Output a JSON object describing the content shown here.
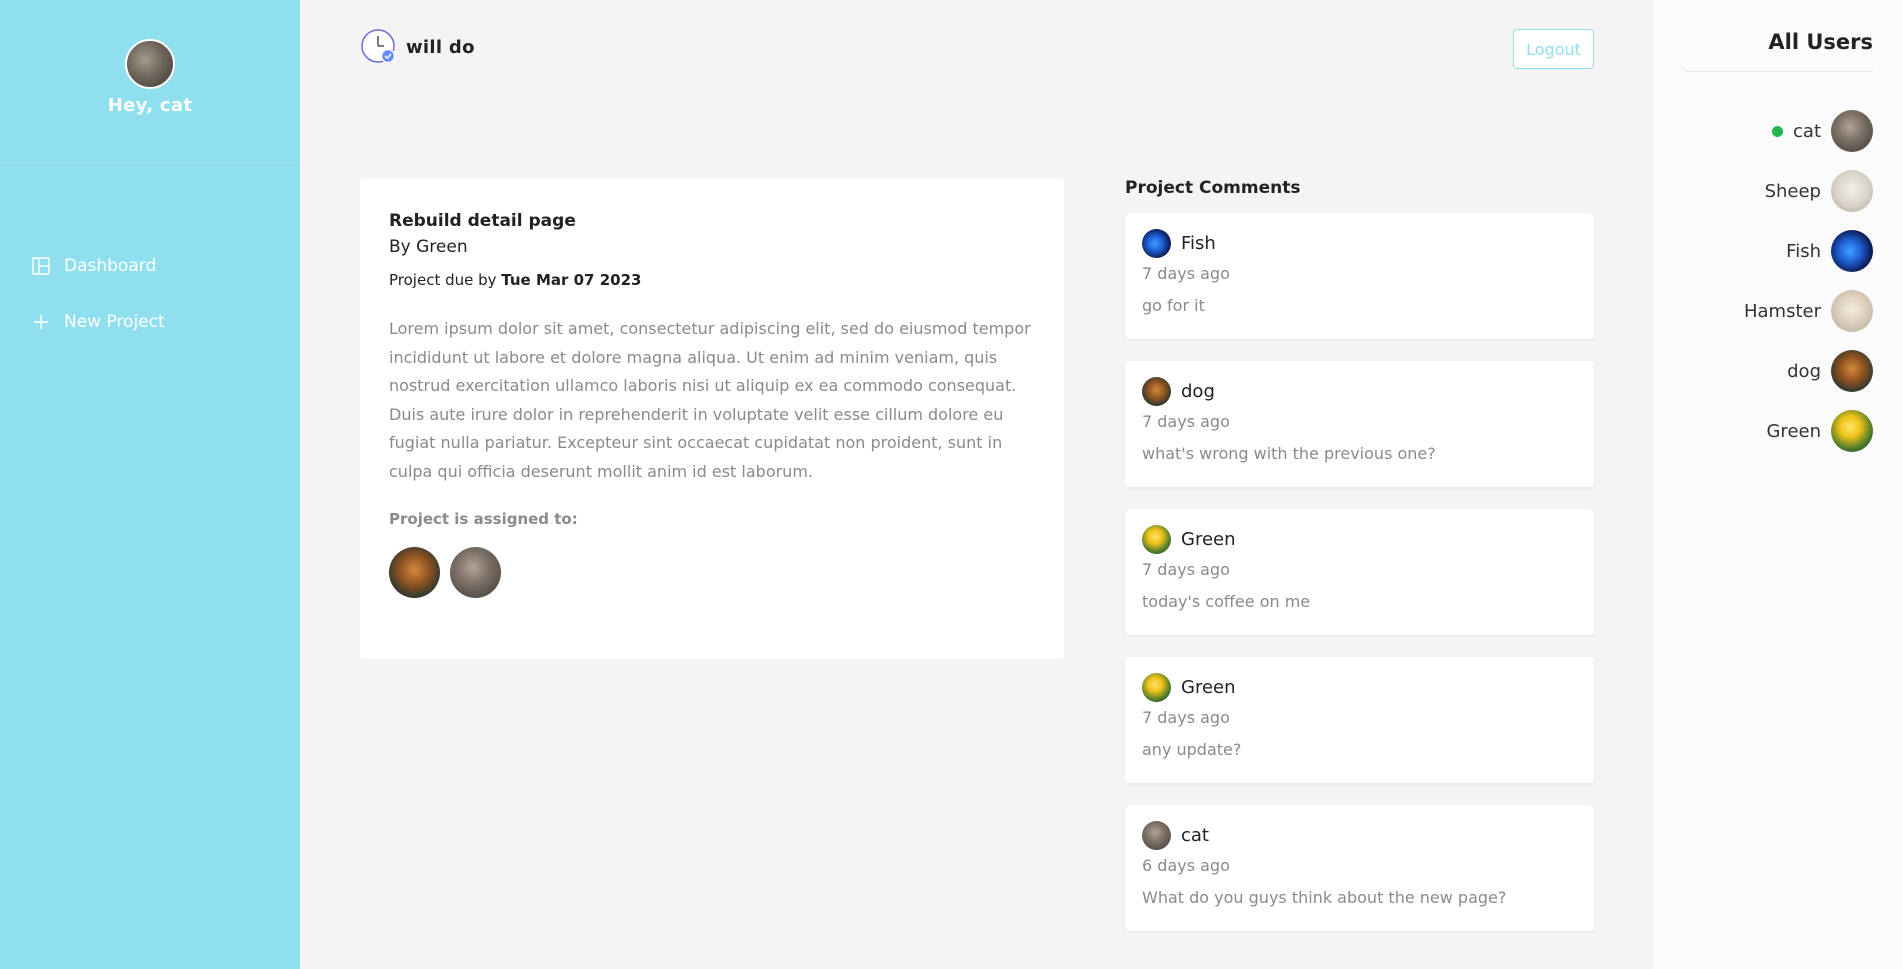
{
  "sidebar": {
    "greeting": "Hey, cat",
    "nav": [
      {
        "label": "Dashboard",
        "icon": "dashboard-icon"
      },
      {
        "label": "New Project",
        "icon": "plus-icon"
      }
    ]
  },
  "header": {
    "brand": "will do",
    "logout_label": "Logout"
  },
  "project": {
    "title": "Rebuild detail page",
    "author": "By Green",
    "due_prefix": "Project due by",
    "due_date": "Tue Mar 07 2023",
    "description": "Lorem ipsum dolor sit amet, consectetur adipiscing elit, sed do eiusmod tempor incididunt ut labore et dolore magna aliqua. Ut enim ad minim veniam, quis nostrud exercitation ullamco laboris nisi ut aliquip ex ea commodo consequat. Duis aute irure dolor in reprehenderit in voluptate velit esse cillum dolore eu fugiat nulla pariatur. Excepteur sint occaecat cupidatat non proident, sunt in culpa qui officia deserunt mollit anim id est laborum.",
    "assigned_label": "Project is assigned to:",
    "assigned": [
      "dog",
      "cat"
    ]
  },
  "comments": {
    "title": "Project Comments",
    "items": [
      {
        "author": "Fish",
        "time": "7 days ago",
        "text": "go for it"
      },
      {
        "author": "dog",
        "time": "7 days ago",
        "text": "what's wrong with the previous one?"
      },
      {
        "author": "Green",
        "time": "7 days ago",
        "text": "today's coffee on me"
      },
      {
        "author": "Green",
        "time": "7 days ago",
        "text": "any update?"
      },
      {
        "author": "cat",
        "time": "6 days ago",
        "text": "What do you guys think about the new page?"
      }
    ]
  },
  "users": {
    "title": "All Users",
    "list": [
      {
        "name": "cat",
        "online": true
      },
      {
        "name": "Sheep",
        "online": false
      },
      {
        "name": "Fish",
        "online": false
      },
      {
        "name": "Hamster",
        "online": false
      },
      {
        "name": "dog",
        "online": false
      },
      {
        "name": "Green",
        "online": false
      }
    ]
  },
  "colors": {
    "sidebar": "#8fdfee",
    "background": "#f4f4f4",
    "online": "#21b652"
  }
}
